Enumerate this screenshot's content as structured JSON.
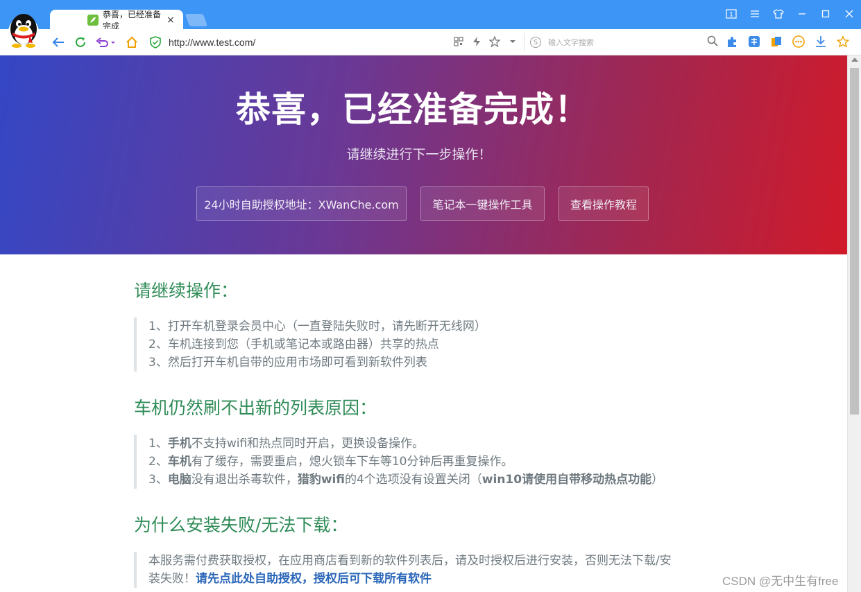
{
  "browser": {
    "tab_title": "恭喜，已经准备完成",
    "tab_close": "×",
    "url": "http://www.test.com/",
    "search_placeholder": "输入文字搜索",
    "win_badge": "1"
  },
  "hero": {
    "title": "恭喜，已经准备完成！",
    "subtitle": "请继续进行下一步操作！",
    "buttons": [
      "24小时自助授权地址：XWanChe.com",
      "笔记本一键操作工具",
      "查看操作教程"
    ]
  },
  "sections": [
    {
      "title": "请继续操作：",
      "items": [
        "1、打开车机登录会员中心（一直登陆失败时，请先断开无线网）",
        "2、车机连接到您（手机或笔记本或路由器）共享的热点",
        "3、然后打开车机自带的应用市场即可看到新软件列表"
      ]
    },
    {
      "title": "车机仍然刷不出新的列表原因：",
      "items": [
        {
          "pre": "1、",
          "bold": "手机",
          "rest": "不支持wifi和热点同时开启，更换设备操作。"
        },
        {
          "pre": "2、",
          "bold": "车机",
          "rest": "有了缓存，需要重启，熄火锁车下车等10分钟后再重复操作。"
        },
        {
          "pre": "3、",
          "bold": "电脑",
          "rest": "没有退出杀毒软件，",
          "bold2": "猎豹wifi",
          "rest2": "的4个选项没有设置关闭（",
          "bold3": "win10请使用自带移动热点功能",
          "rest3": "）"
        }
      ]
    },
    {
      "title": "为什么安装失败/无法下载：",
      "paragraph": "本服务需付费获取授权，在应用商店看到新的软件列表后，请及时授权后进行安装，否则无法下载/安装失败！",
      "link": "请先点此处自助授权，授权后可下载所有软件"
    }
  ],
  "watermark": "CSDN @无中生有free"
}
